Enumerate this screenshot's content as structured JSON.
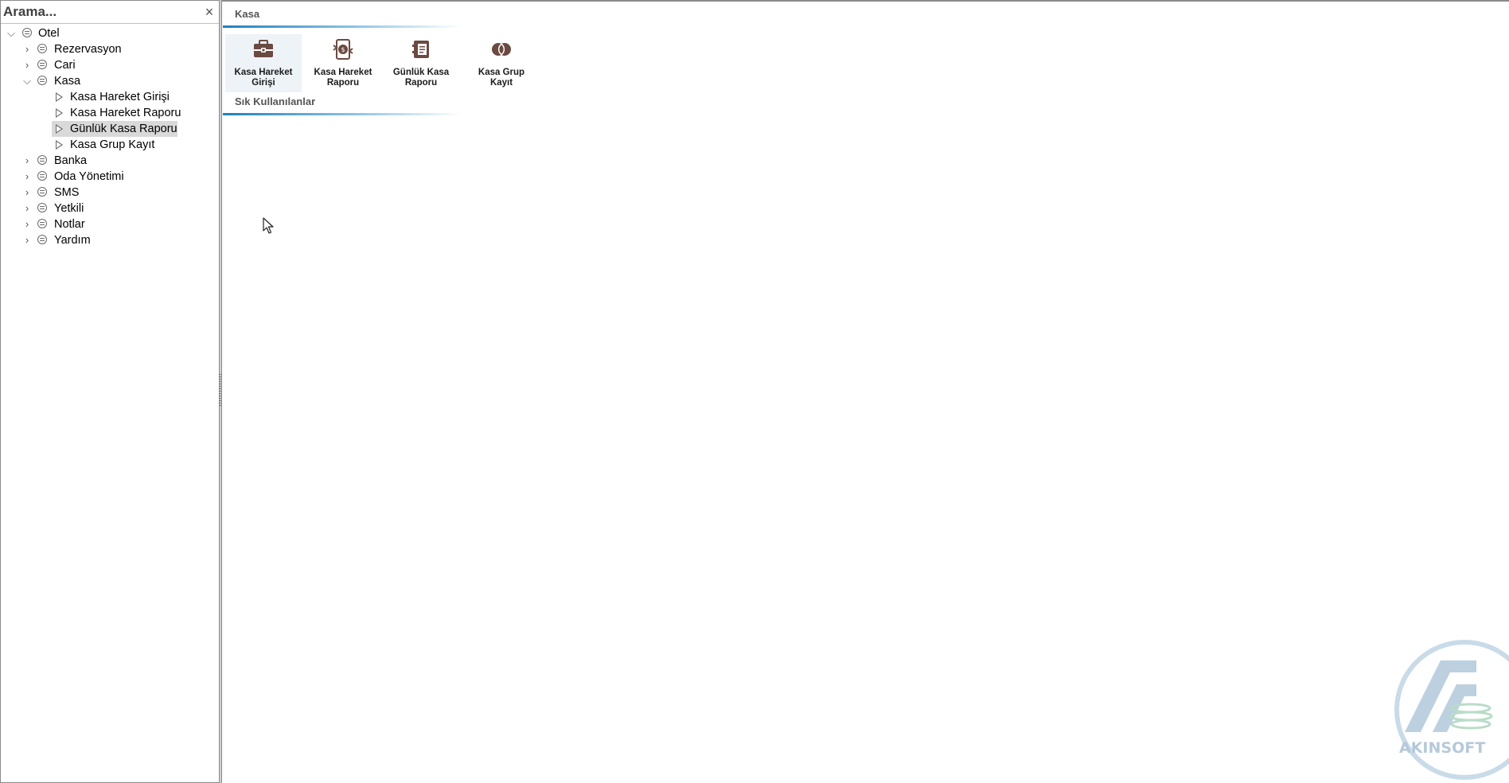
{
  "search": {
    "placeholder": "Arama...",
    "clear_icon": "×"
  },
  "tree": [
    {
      "label": "Otel",
      "type": "root",
      "expanded": true
    },
    {
      "label": "Rezervasyon",
      "type": "group",
      "expanded": false
    },
    {
      "label": "Cari",
      "type": "group",
      "expanded": false
    },
    {
      "label": "Kasa",
      "type": "group",
      "expanded": true
    },
    {
      "label": "Kasa Hareket Girişi",
      "type": "leaf"
    },
    {
      "label": "Kasa Hareket Raporu",
      "type": "leaf"
    },
    {
      "label": "Günlük Kasa Raporu",
      "type": "leaf",
      "selected": true
    },
    {
      "label": "Kasa Grup Kayıt",
      "type": "leaf"
    },
    {
      "label": "Banka",
      "type": "group",
      "expanded": false
    },
    {
      "label": "Oda Yönetimi",
      "type": "group",
      "expanded": false
    },
    {
      "label": "SMS",
      "type": "group",
      "expanded": false
    },
    {
      "label": "Yetkili",
      "type": "group",
      "expanded": false
    },
    {
      "label": "Notlar",
      "type": "group",
      "expanded": false
    },
    {
      "label": "Yardım",
      "type": "group",
      "expanded": false
    }
  ],
  "main": {
    "group_title": "Kasa",
    "tiles": [
      {
        "line1": "Kasa Hareket",
        "line2": "Girişi",
        "icon": "cash-register-icon"
      },
      {
        "line1": "Kasa Hareket",
        "line2": "Raporu",
        "icon": "money-report-icon"
      },
      {
        "line1": "Günlük Kasa",
        "line2": "Raporu",
        "icon": "safe-report-icon"
      },
      {
        "line1": "Kasa Grup",
        "line2": "Kayıt",
        "icon": "group-coins-icon"
      }
    ],
    "section_title": "Sık Kullanılanlar"
  },
  "watermark": {
    "text": "AKINSOFT"
  },
  "colors": {
    "accent": "#1f7fc0",
    "icon_brown": "#6b4a42",
    "selection": "#d9d9d9"
  }
}
